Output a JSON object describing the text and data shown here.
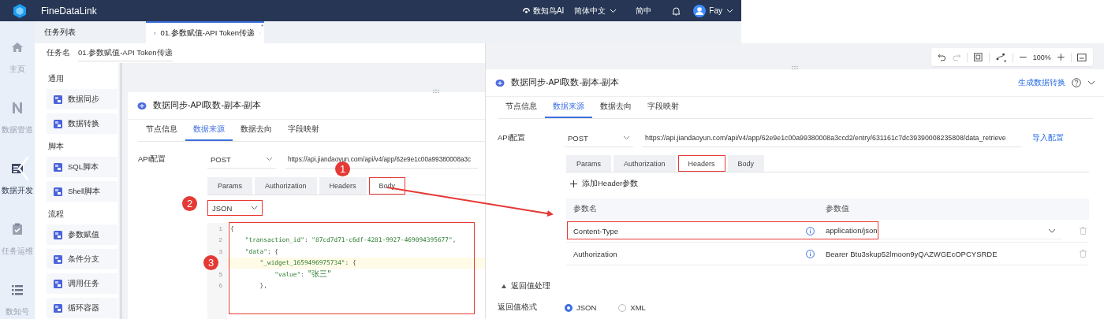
{
  "topbar": {
    "brand": "FineDataLink",
    "ai_label": "数知鸟AI",
    "language": "简体中文",
    "script_toggle": "简中",
    "user": "Fay"
  },
  "nav": [
    {
      "label": "主页",
      "kind": "home",
      "selected": false
    },
    {
      "label": "数据管道",
      "kind": "pipeline",
      "selected": false
    },
    {
      "label": "数据开发",
      "kind": "develop",
      "selected": true
    },
    {
      "label": "任务运维",
      "kind": "ops",
      "selected": false
    },
    {
      "label": "数知号",
      "kind": "list",
      "selected": false
    }
  ],
  "tabbar": {
    "title": "任务列表",
    "tabs": [
      {
        "label": "01.参数赋值-API Token传递",
        "selected": true,
        "mark": "*"
      }
    ]
  },
  "task": {
    "label": "任务名",
    "value": "01.参数赋值-API Token传递"
  },
  "palette": [
    {
      "label": "通用",
      "items": [
        {
          "label": "数据同步"
        },
        {
          "label": "数据转换"
        }
      ]
    },
    {
      "label": "脚本",
      "items": [
        {
          "label": "SQL脚本"
        },
        {
          "label": "Shell脚本"
        }
      ]
    },
    {
      "label": "流程",
      "items": [
        {
          "label": "参数赋值"
        },
        {
          "label": "条件分支"
        },
        {
          "label": "调用任务"
        },
        {
          "label": "循环容器"
        }
      ]
    }
  ],
  "left_node": {
    "title": "数据同步-API取数-副本-副本",
    "tabs": [
      {
        "label": "节点信息",
        "selected": false
      },
      {
        "label": "数据来源",
        "selected": true
      },
      {
        "label": "数据去向",
        "selected": false
      },
      {
        "label": "字段映射",
        "selected": false
      }
    ],
    "api_label": "API配置",
    "method": "POST",
    "url": "https://api.jiandaoyun.com/api/v4/app/62e9e1c00a99380008a3c",
    "request_tabs": [
      {
        "label": "Params",
        "selected": false,
        "marked": false
      },
      {
        "label": "Authorization",
        "selected": false,
        "marked": false
      },
      {
        "label": "Headers",
        "selected": false,
        "marked": false
      },
      {
        "label": "Body",
        "selected": true,
        "marked": true
      }
    ],
    "body_format": {
      "value": "JSON",
      "marked": true
    },
    "editor": {
      "marked": true,
      "lines": [
        {
          "number": "1",
          "text": "{",
          "highlighted": false
        },
        {
          "number": "2",
          "text": "    \"transaction_id\": \"87cd7d71-c6df-4281-9927-469094395677\",",
          "highlighted": false
        },
        {
          "number": "3",
          "text": "    \"data\": {",
          "highlighted": false
        },
        {
          "text": "        \"_widget_1659496975734\": {",
          "highlighted": true
        },
        {
          "number": "5",
          "text": "            \"value\": \"张三\"",
          "highlighted": false
        },
        {
          "number": "6",
          "text": "        },",
          "highlighted": false
        }
      ]
    }
  },
  "right_node": {
    "title": "数据同步-API取数-副本-副本",
    "action": "生成数据转换",
    "tabs": [
      {
        "label": "节点信息",
        "selected": false
      },
      {
        "label": "数据来源",
        "selected": true
      },
      {
        "label": "数据去向",
        "selected": false
      },
      {
        "label": "字段映射",
        "selected": false
      }
    ],
    "api_label": "API配置",
    "method": "POST",
    "url": "https://api.jiandaoyun.com/api/v4/app/62e9e1c00a99380008a3ccd2/entry/631161c7dc39390008235808/data_retrieve",
    "import": "导入配置",
    "request_tabs": [
      {
        "label": "Params",
        "selected": false,
        "marked": false
      },
      {
        "label": "Authorization",
        "selected": false,
        "marked": false
      },
      {
        "label": "Headers",
        "selected": true,
        "marked": true
      },
      {
        "label": "Body",
        "selected": false,
        "marked": false
      }
    ],
    "add_header": "添加Header参数",
    "columns": [
      "参数名",
      "参数值"
    ],
    "headers": [
      {
        "name": "Content-Type",
        "value": "application/json",
        "dropdown": true,
        "marked": true
      },
      {
        "name": "Authorization",
        "value": "Bearer Btu3skup52lmoon9yQAZWGEcOPCYSRDE",
        "dropdown": false,
        "marked": false
      }
    ],
    "section": {
      "label": "返回值处理",
      "expanded": true
    },
    "return_format": {
      "label": "返回值格式",
      "options": [
        {
          "label": "JSON",
          "selected": true
        },
        {
          "label": "XML",
          "selected": false
        }
      ]
    }
  },
  "toolbar": {
    "zoom": "100%"
  },
  "steps": [
    {
      "label": "1"
    },
    {
      "label": "2"
    },
    {
      "label": "3"
    }
  ]
}
